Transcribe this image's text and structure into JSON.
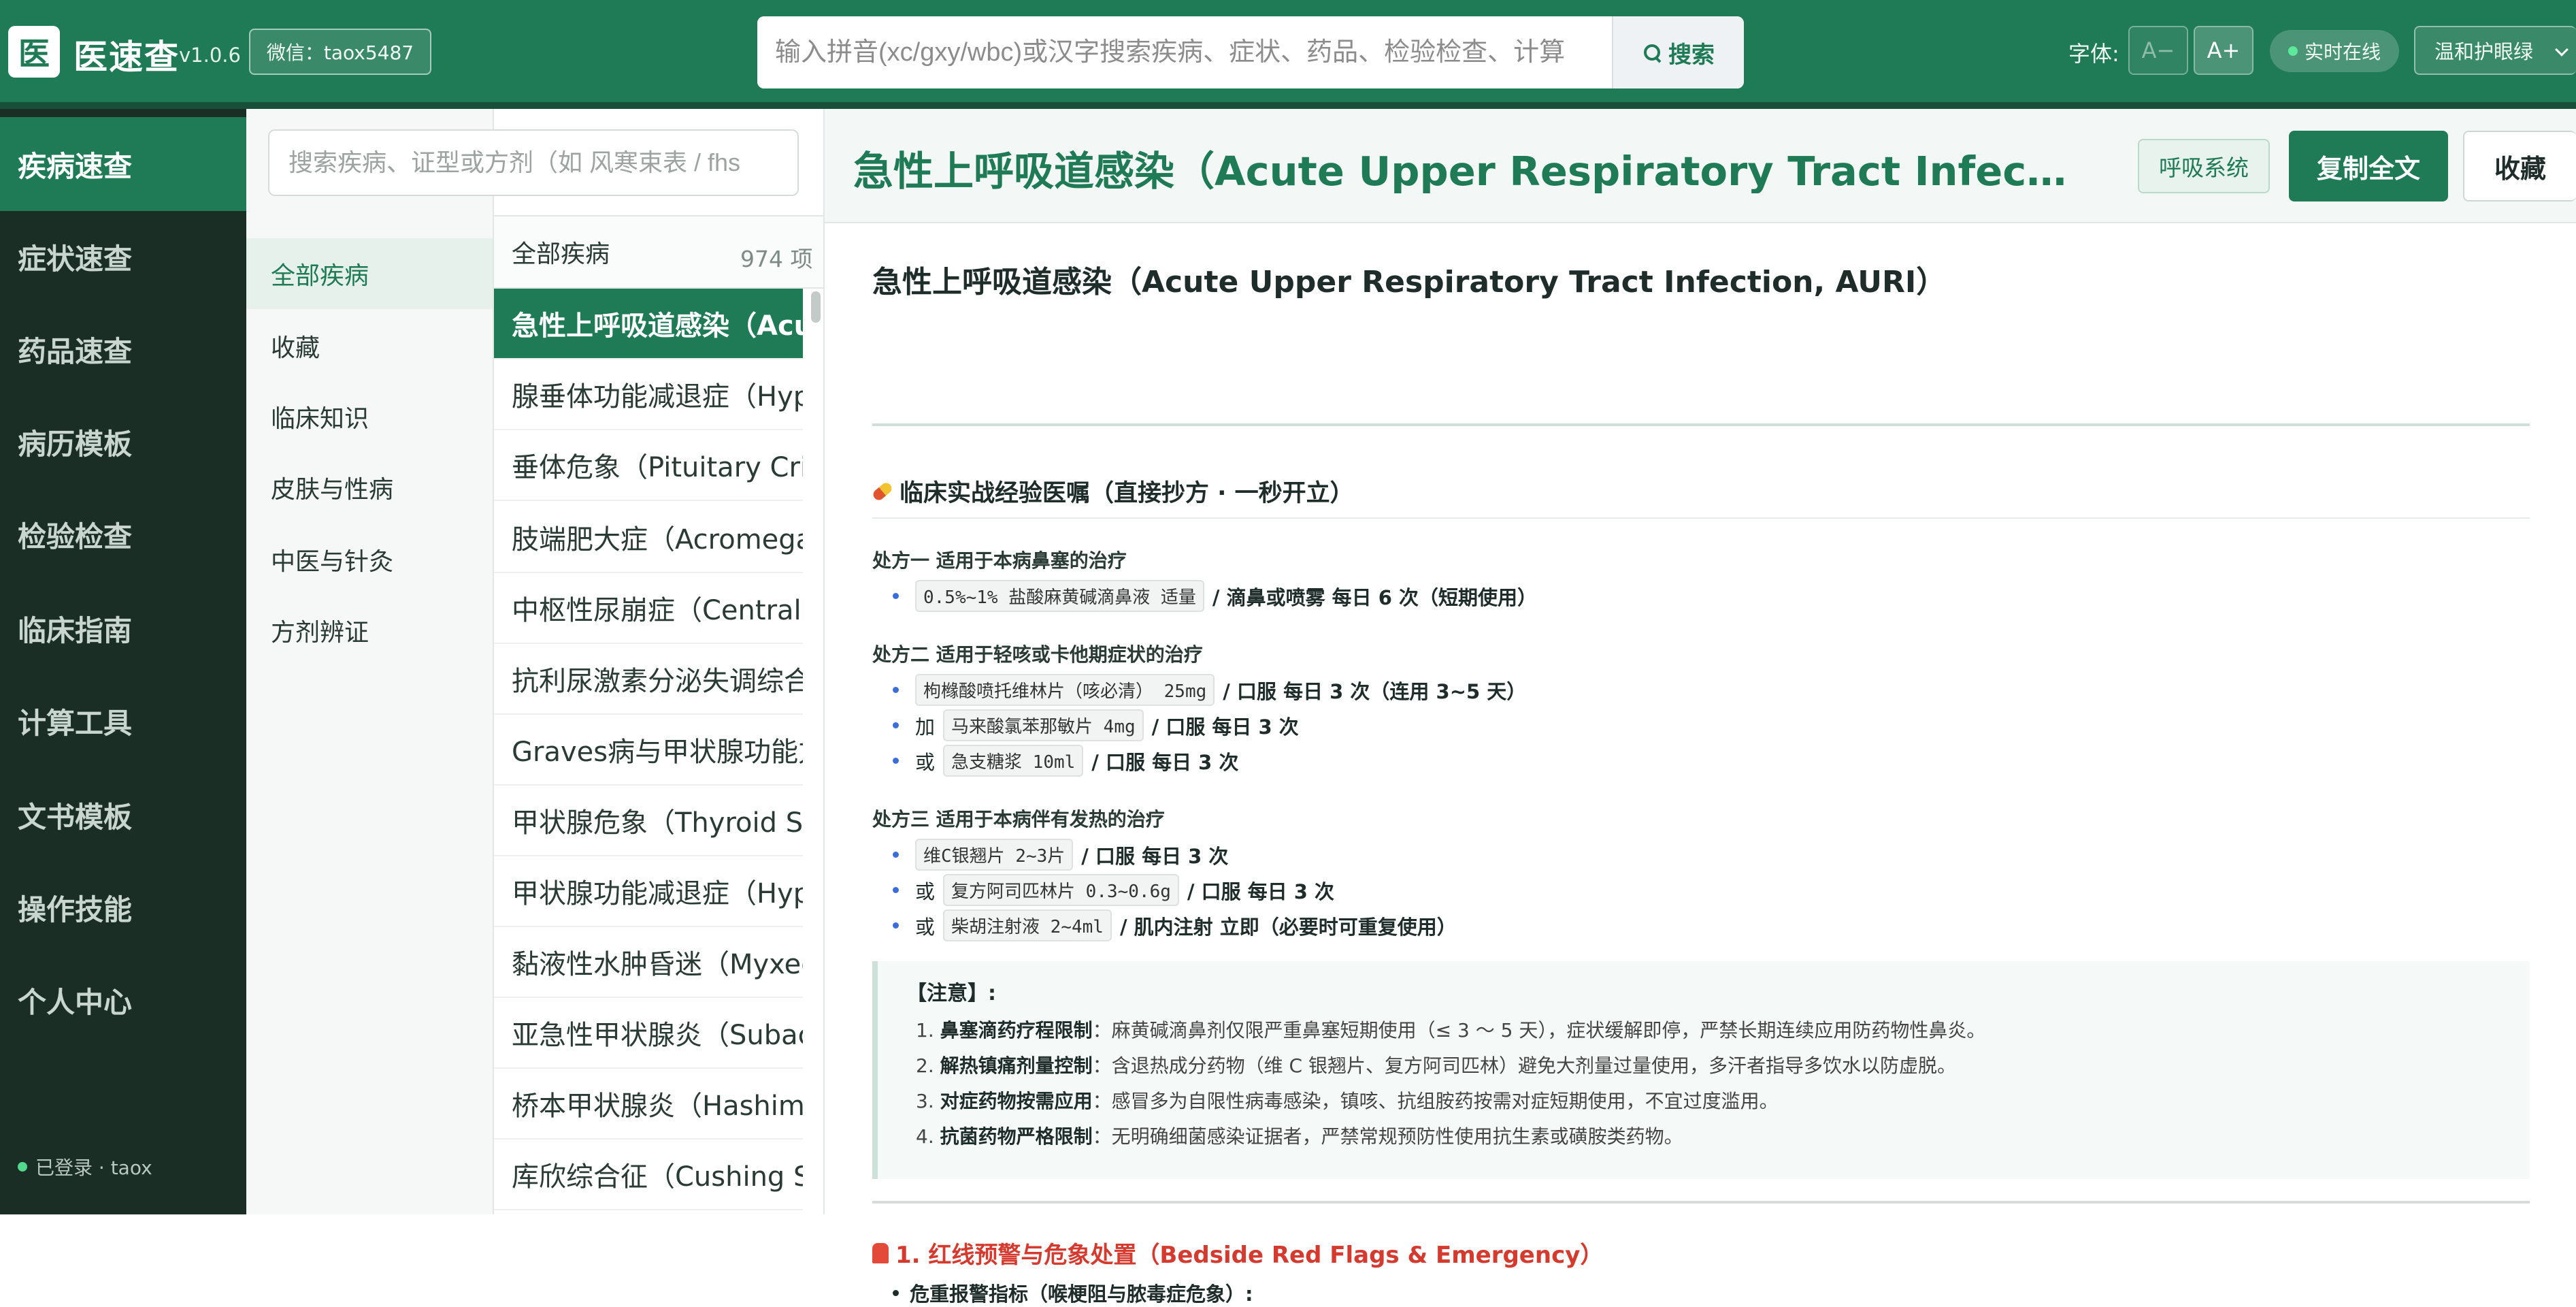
{
  "app": {
    "logo_char": "医",
    "name": "医速查",
    "version": "v1.0.6",
    "wechat": "微信：taox5487"
  },
  "search": {
    "placeholder": "输入拼音(xc/gxy/wbc)或汉字搜索疾病、症状、药品、检验检查、计算",
    "button_label": "搜索"
  },
  "toolbar": {
    "font_label": "字体:",
    "font_decrease": "A−",
    "font_increase": "A+",
    "live_status": "实时在线",
    "theme": "温和护眼绿"
  },
  "nav": {
    "items": [
      {
        "label": "疾病速查",
        "active": true
      },
      {
        "label": "症状速查"
      },
      {
        "label": "药品速查"
      },
      {
        "label": "病历模板"
      },
      {
        "label": "检验检查"
      },
      {
        "label": "临床指南"
      },
      {
        "label": "计算工具"
      },
      {
        "label": "文书模板"
      },
      {
        "label": "操作技能"
      },
      {
        "label": "个人中心"
      }
    ],
    "login_status": "已登录 · taox"
  },
  "categories": {
    "search_placeholder": "搜索疾病、证型或方剂（如 风寒束表 / fhs",
    "items": [
      {
        "label": "全部疾病",
        "active": true
      },
      {
        "label": "收藏"
      },
      {
        "label": "临床知识"
      },
      {
        "label": "皮肤与性病"
      },
      {
        "label": "中医与针灸"
      },
      {
        "label": "方剂辨证"
      }
    ]
  },
  "disease_list": {
    "header": "全部疾病",
    "count": "974 项",
    "items": [
      {
        "label": "急性上呼吸道感染（Acute Upper Respiratory Tract Infection, AURI）",
        "active": true
      },
      {
        "label": "腺垂体功能减退症（Hypopituitarism）"
      },
      {
        "label": "垂体危象（Pituitary Crisis）"
      },
      {
        "label": "肢端肥大症（Acromegaly）"
      },
      {
        "label": "中枢性尿崩症（Central Diabetes Insipidus）"
      },
      {
        "label": "抗利尿激素分泌失调综合征"
      },
      {
        "label": "Graves病与甲状腺功能亢进症"
      },
      {
        "label": "甲状腺危象（Thyroid Storm）"
      },
      {
        "label": "甲状腺功能减退症（Hypothyroidism）"
      },
      {
        "label": "黏液性水肿昏迷（Myxedema Coma）"
      },
      {
        "label": "亚急性甲状腺炎（Subacute Thyroiditis）"
      },
      {
        "label": "桥本甲状腺炎（Hashimoto's Thyroiditis）"
      },
      {
        "label": "库欣综合征（Cushing Syndrome）"
      }
    ]
  },
  "main": {
    "title": "急性上呼吸道感染（Acute Upper Respiratory Tract Infection, AURI）",
    "system_tag": "呼吸系统",
    "copy_label": "复制全文",
    "favorite_label": "收藏",
    "doc_title": "急性上呼吸道感染（Acute Upper Respiratory Tract Infection, AURI）",
    "clinical_section": "临床实战经验医嘱（直接抄方 · 一秒开立）",
    "prescriptions": [
      {
        "heading": "处方一 适用于本病鼻塞的治疗",
        "lines": [
          {
            "prefix": "",
            "drug": "0.5%~1% 盐酸麻黄碱滴鼻液 适量",
            "usage": "/ 滴鼻或喷雾 每日 6 次（短期使用）"
          }
        ]
      },
      {
        "heading": "处方二 适用于轻咳或卡他期症状的治疗",
        "lines": [
          {
            "prefix": "",
            "drug": "枸橼酸喷托维林片（咳必清） 25mg",
            "usage": "/ 口服 每日 3 次（连用 3~5 天）"
          },
          {
            "prefix": "加",
            "drug": "马来酸氯苯那敏片 4mg",
            "usage": "/ 口服 每日 3 次"
          },
          {
            "prefix": "或",
            "drug": "急支糖浆 10ml",
            "usage": "/ 口服 每日 3 次"
          }
        ]
      },
      {
        "heading": "处方三 适用于本病伴有发热的治疗",
        "lines": [
          {
            "prefix": "",
            "drug": "维C银翘片 2~3片",
            "usage": "/ 口服 每日 3 次"
          },
          {
            "prefix": "或",
            "drug": "复方阿司匹林片 0.3~0.6g",
            "usage": "/ 口服 每日 3 次"
          },
          {
            "prefix": "或",
            "drug": "柴胡注射液 2~4ml",
            "usage": "/ 肌内注射 立即（必要时可重复使用）"
          }
        ]
      }
    ],
    "notice": {
      "title": "【注意】:",
      "items": [
        {
          "num": "1.",
          "label": "鼻塞滴药疗程限制",
          "text": "：麻黄碱滴鼻剂仅限严重鼻塞短期使用（≤ 3 ～ 5 天），症状缓解即停，严禁长期连续应用防药物性鼻炎。"
        },
        {
          "num": "2.",
          "label": "解热镇痛剂量控制",
          "text": "：含退热成分药物（维 C 银翘片、复方阿司匹林）避免大剂量过量使用，多汗者指导多饮水以防虚脱。"
        },
        {
          "num": "3.",
          "label": "对症药物按需应用",
          "text": "：感冒多为自限性病毒感染，镇咳、抗组胺药按需对症短期使用，不宜过度滥用。"
        },
        {
          "num": "4.",
          "label": "抗菌药物严格限制",
          "text": "：无明确细菌感染证据者，严禁常规预防性使用抗生素或磺胺类药物。"
        }
      ]
    },
    "red_flags_title": "1. 红线预警与危象处置（Bedside Red Flags & Emergency）",
    "red_flags_sub": "危重报警指标（喉梗阻与脓毒症危象）:"
  }
}
